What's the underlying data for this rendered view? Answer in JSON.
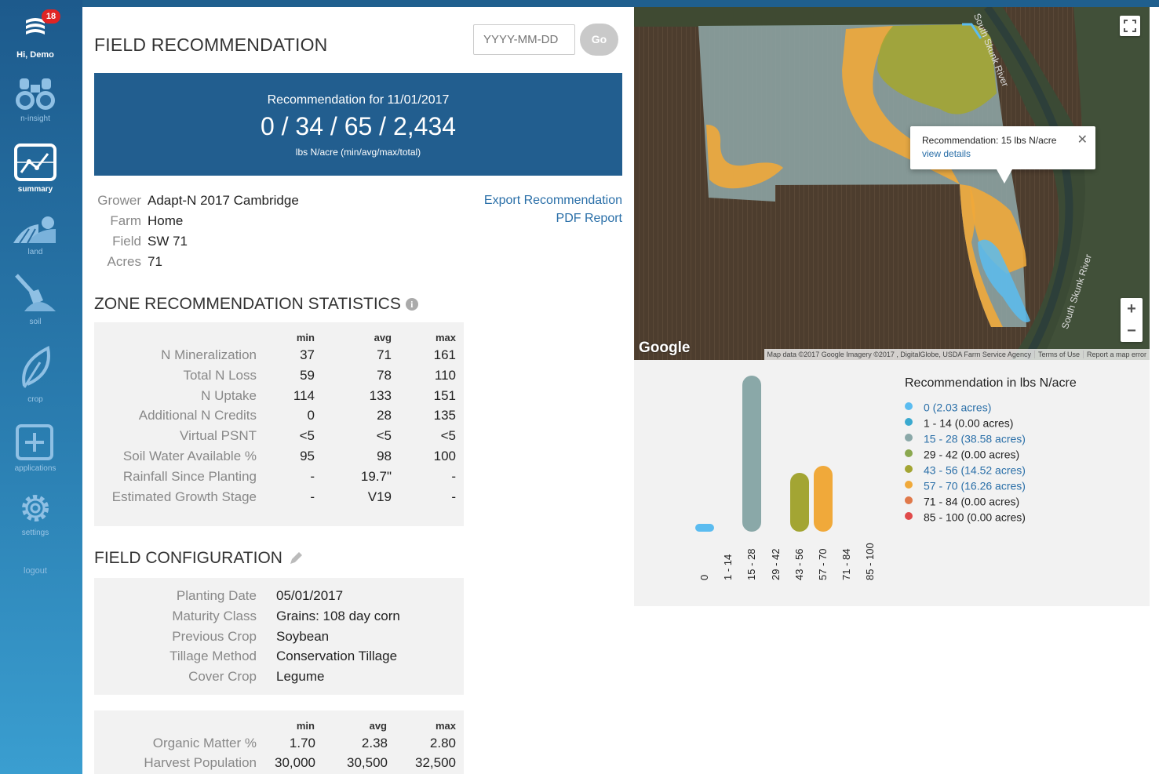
{
  "sidebar": {
    "badge_count": "18",
    "greeting": "Hi, Demo",
    "items": [
      {
        "label": "n-insight",
        "icon": "binoculars-icon"
      },
      {
        "label": "summary",
        "icon": "chart-line-icon"
      },
      {
        "label": "land",
        "icon": "field-sun-icon"
      },
      {
        "label": "soil",
        "icon": "shovel-icon"
      },
      {
        "label": "crop",
        "icon": "leaf-icon"
      },
      {
        "label": "applications",
        "icon": "plus-square-icon"
      },
      {
        "label": "settings",
        "icon": "gear-icon"
      }
    ],
    "logout": "logout"
  },
  "header": {
    "title": "FIELD RECOMMENDATION",
    "date_placeholder": "YYYY-MM-DD",
    "go_label": "Go"
  },
  "recommendation": {
    "for_label": "Recommendation for 11/01/2017",
    "value": "0 / 34 / 65 / 2,434",
    "unit": "lbs N/acre (min/avg/max/total)"
  },
  "field_info": {
    "rows": [
      {
        "label": "Grower",
        "value": "Adapt-N 2017 Cambridge"
      },
      {
        "label": "Farm",
        "value": "Home"
      },
      {
        "label": "Field",
        "value": "SW 71"
      },
      {
        "label": "Acres",
        "value": "71"
      }
    ],
    "export_link": "Export Recommendation",
    "pdf_link": "PDF Report"
  },
  "zone_stats": {
    "title": "ZONE RECOMMENDATION STATISTICS",
    "columns": [
      "min",
      "avg",
      "max"
    ],
    "rows": [
      {
        "label": "N Mineralization",
        "min": "37",
        "avg": "71",
        "max": "161"
      },
      {
        "label": "Total N Loss",
        "min": "59",
        "avg": "78",
        "max": "110"
      },
      {
        "label": "N Uptake",
        "min": "114",
        "avg": "133",
        "max": "151"
      },
      {
        "label": "Additional N Credits",
        "min": "0",
        "avg": "28",
        "max": "135"
      },
      {
        "label": "Virtual PSNT",
        "min": "<5",
        "avg": "<5",
        "max": "<5"
      },
      {
        "label": "Soil Water Available %",
        "min": "95",
        "avg": "98",
        "max": "100"
      },
      {
        "label": "Rainfall Since Planting",
        "min": "-",
        "avg": "19.7\"",
        "max": "-"
      },
      {
        "label": "Estimated Growth Stage",
        "min": "-",
        "avg": "V19",
        "max": "-"
      }
    ]
  },
  "field_config": {
    "title": "FIELD CONFIGURATION",
    "rows": [
      {
        "label": "Planting Date",
        "value": "05/01/2017"
      },
      {
        "label": "Maturity Class",
        "value": "Grains: 108 day corn"
      },
      {
        "label": "Previous Crop",
        "value": "Soybean"
      },
      {
        "label": "Tillage Method",
        "value": "Conservation Tillage"
      },
      {
        "label": "Cover Crop",
        "value": "Legume"
      }
    ]
  },
  "soil_stats": {
    "columns": [
      "min",
      "avg",
      "max"
    ],
    "rows": [
      {
        "label": "Organic Matter %",
        "min": "1.70",
        "avg": "2.38",
        "max": "2.80"
      },
      {
        "label": "Harvest Population",
        "min": "30,000",
        "avg": "30,500",
        "max": "32,500"
      }
    ]
  },
  "map": {
    "river_label_1": "South Skunk River",
    "river_label_2": "South Skunk River",
    "google_logo": "Google",
    "attribution": [
      "Map data ©2017 Google Imagery ©2017 , DigitalGlobe, USDA Farm Service Agency",
      "Terms of Use",
      "Report a map error"
    ],
    "popup_text": "Recommendation: 15 lbs N/acre",
    "popup_link": "view details",
    "zoom_in": "+",
    "zoom_out": "−"
  },
  "chart_data": {
    "type": "bar",
    "title": "Recommendation in lbs N/acre",
    "categories": [
      "0",
      "1 - 14",
      "15 - 28",
      "29 - 42",
      "43 - 56",
      "57 - 70",
      "71 - 84",
      "85 - 100"
    ],
    "values": [
      2.03,
      0.0,
      38.58,
      0.0,
      14.52,
      16.26,
      0.0,
      0.0
    ],
    "colors": [
      "#5bbcf0",
      "#3aa9cf",
      "#8aa8a8",
      "#8aa84f",
      "#a3a533",
      "#f0a93a",
      "#e0794a",
      "#e04a4a"
    ],
    "legend": [
      {
        "label": "0 (2.03 acres)",
        "color": "#5bbcf0",
        "linked": true
      },
      {
        "label": "1 - 14 (0.00 acres)",
        "color": "#3aa9cf",
        "linked": false
      },
      {
        "label": "15 - 28 (38.58 acres)",
        "color": "#8aa8a8",
        "linked": true
      },
      {
        "label": "29 - 42 (0.00 acres)",
        "color": "#8aa84f",
        "linked": false
      },
      {
        "label": "43 - 56 (14.52 acres)",
        "color": "#a3a533",
        "linked": true
      },
      {
        "label": "57 - 70 (16.26 acres)",
        "color": "#f0a93a",
        "linked": true
      },
      {
        "label": "71 - 84 (0.00 acres)",
        "color": "#e0794a",
        "linked": false
      },
      {
        "label": "85 - 100 (0.00 acres)",
        "color": "#e04a4a",
        "linked": false
      }
    ]
  }
}
